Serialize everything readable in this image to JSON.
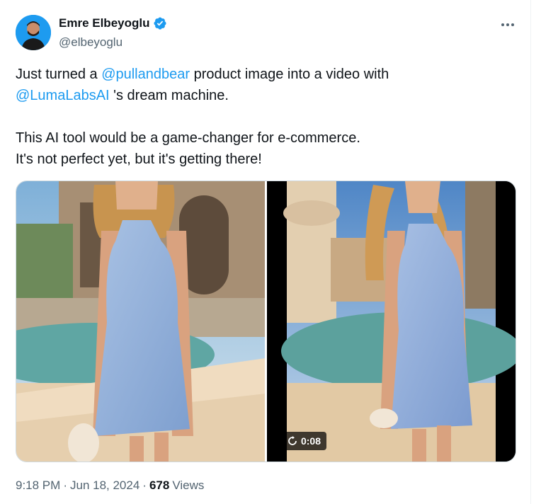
{
  "author": {
    "display_name": "Emre Elbeyoglu",
    "handle": "@elbeyoglu",
    "verified": true,
    "avatar_icon": "avatar-photo"
  },
  "menu": {
    "more_icon": "more-horizontal-icon"
  },
  "tweet": {
    "line1_prefix": "Just turned a ",
    "mention1": "@pullandbear",
    "line1_suffix": " product image into a video with",
    "mention2": "@LumaLabsAI",
    "line2_suffix": " 's dream machine.",
    "line3": "This AI tool would be a game-changer for e-commerce.",
    "line4": "It's not perfect yet, but it's getting there!"
  },
  "media": {
    "left_image": "product-photo",
    "right_video": "generated-video",
    "video_duration": "0:08",
    "replay_icon": "replay-icon"
  },
  "meta": {
    "time": "9:18 PM",
    "separator": "·",
    "date": "Jun 18, 2024",
    "views_count": "678",
    "views_label": "Views"
  },
  "colors": {
    "accent": "#1d9bf0",
    "text_primary": "#0f1419",
    "text_secondary": "#536471",
    "border": "#cfd9de"
  }
}
